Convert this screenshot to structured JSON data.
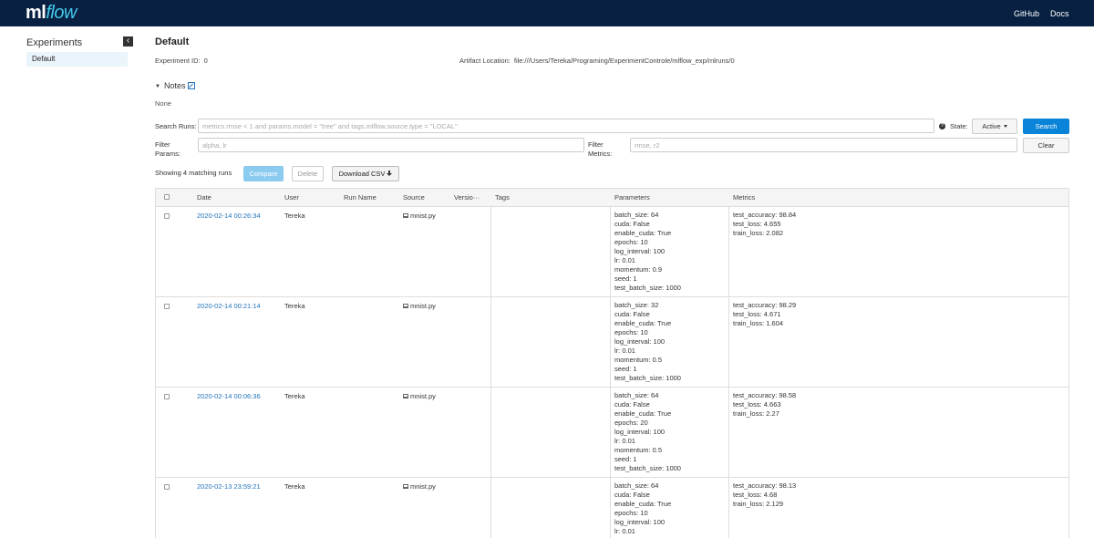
{
  "header": {
    "logo_ml": "ml",
    "logo_flow": "flow",
    "links": [
      "GitHub",
      "Docs"
    ]
  },
  "sidebar": {
    "title": "Experiments",
    "collapse_glyph": "‹",
    "items": [
      {
        "label": "Default",
        "selected": true
      }
    ]
  },
  "experiment": {
    "name": "Default",
    "id_label": "Experiment ID:",
    "id_value": "0",
    "artifact_label": "Artifact Location:",
    "artifact_value": "file:///Users/Tereka/Programing/ExperimentControle/mlflow_exp/mlruns/0",
    "notes_label": "Notes",
    "notes_value": "None"
  },
  "search": {
    "search_runs_label": "Search Runs:",
    "search_placeholder": "metrics.rmse < 1 and params.model = \"tree\" and tags.mlflow.source.type = \"LOCAL\"",
    "state_label": "State:",
    "state_value": "Active",
    "search_button": "Search",
    "filter_params_label_1": "Filter",
    "filter_params_label_2": "Params:",
    "filter_params_placeholder": "alpha, lr",
    "filter_metrics_label_1": "Filter",
    "filter_metrics_label_2": "Metrics:",
    "filter_metrics_placeholder": "rmse, r2",
    "clear_button": "Clear"
  },
  "toolbar": {
    "matching_text": "Showing 4 matching runs",
    "compare_label": "Compare",
    "delete_label": "Delete",
    "download_label": "Download CSV"
  },
  "table": {
    "columns": {
      "date": "Date",
      "user": "User",
      "run_name": "Run Name",
      "source": "Source",
      "version": "Versio···",
      "tags": "Tags",
      "parameters": "Parameters",
      "metrics": "Metrics"
    },
    "rows": [
      {
        "date": "2020-02-14 00:26:34",
        "user": "Tereka",
        "source": "mnist.py",
        "params": [
          "batch_size: 64",
          "cuda: False",
          "enable_cuda: True",
          "epochs: 10",
          "log_interval: 100",
          "lr: 0.01",
          "momentum: 0.9",
          "seed: 1",
          "test_batch_size: 1000"
        ],
        "metrics": [
          "test_accuracy: 98.84",
          "test_loss: 4.655",
          "train_loss: 2.082"
        ]
      },
      {
        "date": "2020-02-14 00:21:14",
        "user": "Tereka",
        "source": "mnist.py",
        "params": [
          "batch_size: 32",
          "cuda: False",
          "enable_cuda: True",
          "epochs: 10",
          "log_interval: 100",
          "lr: 0.01",
          "momentum: 0.5",
          "seed: 1",
          "test_batch_size: 1000"
        ],
        "metrics": [
          "test_accuracy: 98.29",
          "test_loss: 4.671",
          "train_loss: 1.604"
        ]
      },
      {
        "date": "2020-02-14 00:06:36",
        "user": "Tereka",
        "source": "mnist.py",
        "params": [
          "batch_size: 64",
          "cuda: False",
          "enable_cuda: True",
          "epochs: 20",
          "log_interval: 100",
          "lr: 0.01",
          "momentum: 0.5",
          "seed: 1",
          "test_batch_size: 1000"
        ],
        "metrics": [
          "test_accuracy: 98.58",
          "test_loss: 4.663",
          "train_loss: 2.27"
        ]
      },
      {
        "date": "2020-02-13 23:59:21",
        "user": "Tereka",
        "source": "mnist.py",
        "params": [
          "batch_size: 64",
          "cuda: False",
          "enable_cuda: True",
          "epochs: 10",
          "log_interval: 100",
          "lr: 0.01"
        ],
        "metrics": [
          "test_accuracy: 98.13",
          "test_loss: 4.68",
          "train_loss: 2.129"
        ]
      }
    ]
  }
}
